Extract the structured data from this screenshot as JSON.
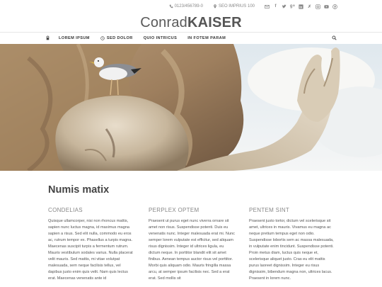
{
  "topbar": {
    "phone": "0123/456789-0",
    "address": "SEO IMPRIUS 100",
    "social_icons": [
      "mail-icon",
      "facebook-icon",
      "twitter-icon",
      "google-plus-icon",
      "linkedin-icon",
      "xing-icon",
      "instagram-icon",
      "youtube-icon",
      "pinterest-icon"
    ]
  },
  "logo": {
    "light": "Conrad",
    "bold": "KAISER"
  },
  "nav": {
    "items": [
      {
        "label": "LOREM IPSUM"
      },
      {
        "label": "SED DOLOR"
      },
      {
        "label": "QUIO INTRICUS"
      },
      {
        "label": "IN FOTEM PARAM"
      }
    ]
  },
  "main": {
    "title": "Numis matix",
    "columns": [
      {
        "heading": "CONDELIAS",
        "text": "Quisque ullamcorper, nisi non rhoncus mattis, sapien nunc luctus magna, id maximus magna sapien a risus. Sed elit nulla, commodo eu eros ac, rutrum tempor ex. Phasellus a turpis magna. Maecenas suscipit turpis a fermentum rutrum. Mauris vestibulum sodales varius. Nulla placerat velit mauris. Sed mattis, mi vitae volutpat malesuada, sem neque facilisis tellus, vel dapibus justo enim quis velit. Nam quis lectus erat. Maecenas venenatis ante id"
      },
      {
        "heading": "PERPLEX OPTEM",
        "text": "Praesent ut purus eget nunc viverra ornare sit amet non risus. Suspendisse potenti. Duis eu venenatis nunc. Integer malesuada erat mi. Nunc semper lorem vulputate est efficitur, sed aliquam risus dignissim. Integer id ultrices ligula, eu dictum neque. In porttitor blandit elit sit amet finibus. Aenean tempus auctor risus vel porttitor. Morbi quis aliquam odio. Mauris fringilla massa arcu, at semper ipsum facilisis nec. Sed a erat erat. Sed mollis sit"
      },
      {
        "heading": "PENTEM SINT",
        "text": "Praesent justo tortor, dictum vel scelerisque sit amet, ultrices in mauris. Vivamus eu magna ac neque pretium tempus eget non odio. Suspendisse lobortis sem ac massa malesuada, in vulputate enim tincidunt. Suspendisse potenti. Proin metus diam, luctus quis neque et, scelerisque aliquet justo. Cras eu elit mattis purus laoreet dignissim. Integer eu risus dignissim, bibendum magna non, ultrices lacus. Praesent in lorem nunc."
      }
    ]
  },
  "colors": {
    "text": "#555555",
    "heading": "#888888",
    "nav": "#333333",
    "border": "#e6e6e6"
  }
}
